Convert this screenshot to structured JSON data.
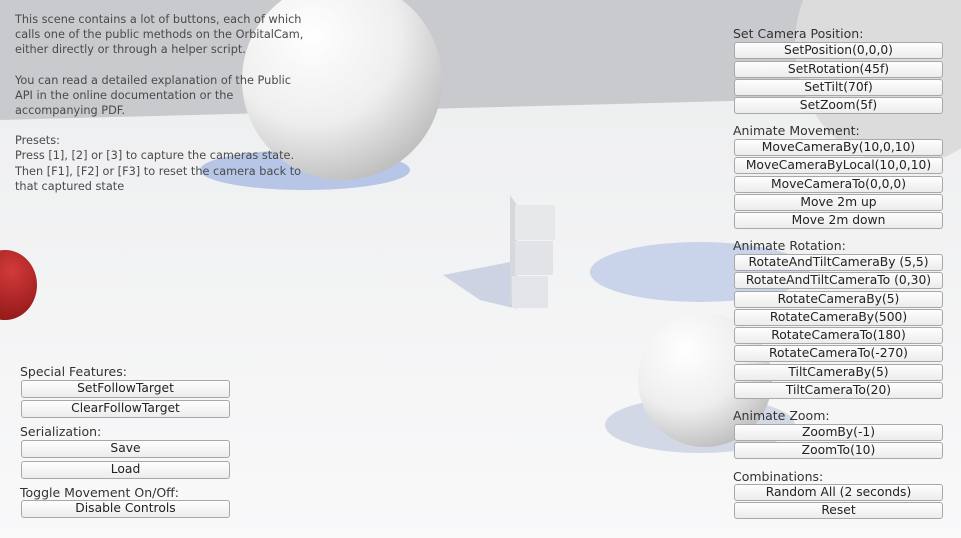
{
  "info": {
    "paragraphs": [
      "This scene contains a lot of buttons, each of which calls one of the public methods on the OrbitalCam, either directly or through a helper script.",
      "You can read a detailed explanation of the Public API in the online documentation or the accompanying PDF.",
      "Presets:\nPress [1], [2] or [3] to capture the cameras state.\nThen [F1], [F2] or [F3] to reset the camera back to that captured state"
    ]
  },
  "right_panel": {
    "set_camera_position": {
      "title": "Set Camera Position:",
      "buttons": [
        "SetPosition(0,0,0)",
        "SetRotation(45f)",
        "SetTilt(70f)",
        "SetZoom(5f)"
      ]
    },
    "animate_movement": {
      "title": "Animate Movement:",
      "buttons": [
        "MoveCameraBy(10,0,10)",
        "MoveCameraByLocal(10,0,10)",
        "MoveCameraTo(0,0,0)",
        "Move 2m up",
        "Move 2m down"
      ]
    },
    "animate_rotation": {
      "title": "Animate Rotation:",
      "buttons": [
        "RotateAndTiltCameraBy (5,5)",
        "RotateAndTiltCameraTo (0,30)",
        "RotateCameraBy(5)",
        "RotateCameraBy(500)",
        "RotateCameraTo(180)",
        "RotateCameraTo(-270)",
        "TiltCameraBy(5)",
        "TiltCameraTo(20)"
      ]
    },
    "animate_zoom": {
      "title": "Animate Zoom:",
      "buttons": [
        "ZoomBy(-1)",
        "ZoomTo(10)"
      ]
    },
    "combinations": {
      "title": "Combinations:",
      "buttons": [
        "Random All (2 seconds)",
        "Reset"
      ]
    }
  },
  "left_panel": {
    "special_features": {
      "title": "Special Features:",
      "buttons": [
        "SetFollowTarget",
        "ClearFollowTarget"
      ]
    },
    "serialization": {
      "title": "Serialization:",
      "buttons": [
        "Save",
        "Load"
      ]
    },
    "toggle_movement": {
      "title": "Toggle Movement On/Off:",
      "buttons": [
        "Disable Controls"
      ]
    }
  },
  "colors": {
    "sky": "#c7c9cc",
    "ground": "#f4f5f6",
    "sphere": "#f2f2f2",
    "red_object": "#b01e1e",
    "shadow": "#bfcbe6"
  }
}
